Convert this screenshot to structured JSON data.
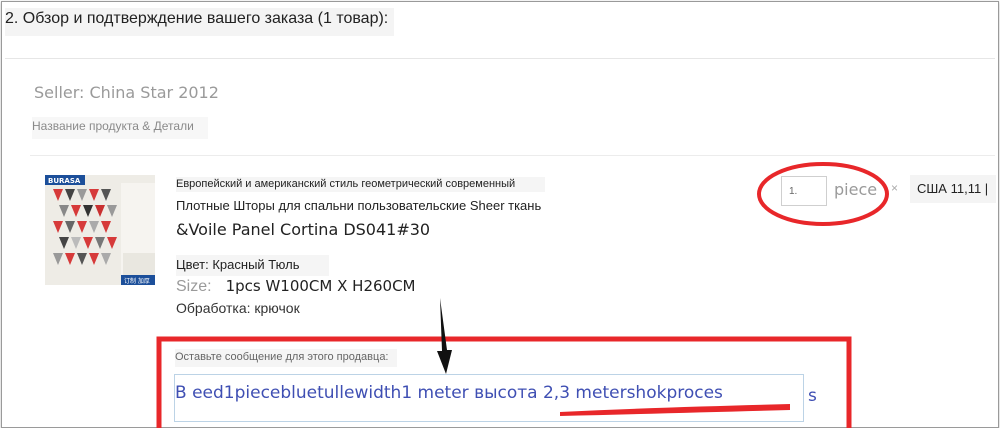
{
  "section": {
    "title": "2. Обзор и подтверждение вашего заказа (1 товар):"
  },
  "order": {
    "seller": "Seller: China Star 2012",
    "column_header": "Название продукта & Детали",
    "product": {
      "line1": "Европейский и американский стиль геометрический современный",
      "line2": "Плотные Шторы для спальни пользовательские Sheer ткань",
      "line3": "&Voile Panel Cortina DS041#30",
      "color": "Цвет: Красный Тюль",
      "size_label": "Size:",
      "size_value": "1pcs W100CM X H260CM",
      "processing": "Обработка: крючок",
      "image_badge": "BURASA",
      "image_corner_text": "订制 加厚"
    },
    "quantity": {
      "value": "1.",
      "unit": "piece",
      "multiply_sign": "×"
    },
    "price": "США 11,11 |"
  },
  "message": {
    "label": "Оставьте сообщение для этого продавца:",
    "text": "В eed1piecebluetullewidth1 meter высота 2,3 metershokproces",
    "overflow_tail": "s"
  },
  "colors": {
    "annotation_red": "#e8272a",
    "message_text": "#3f4fb3"
  }
}
